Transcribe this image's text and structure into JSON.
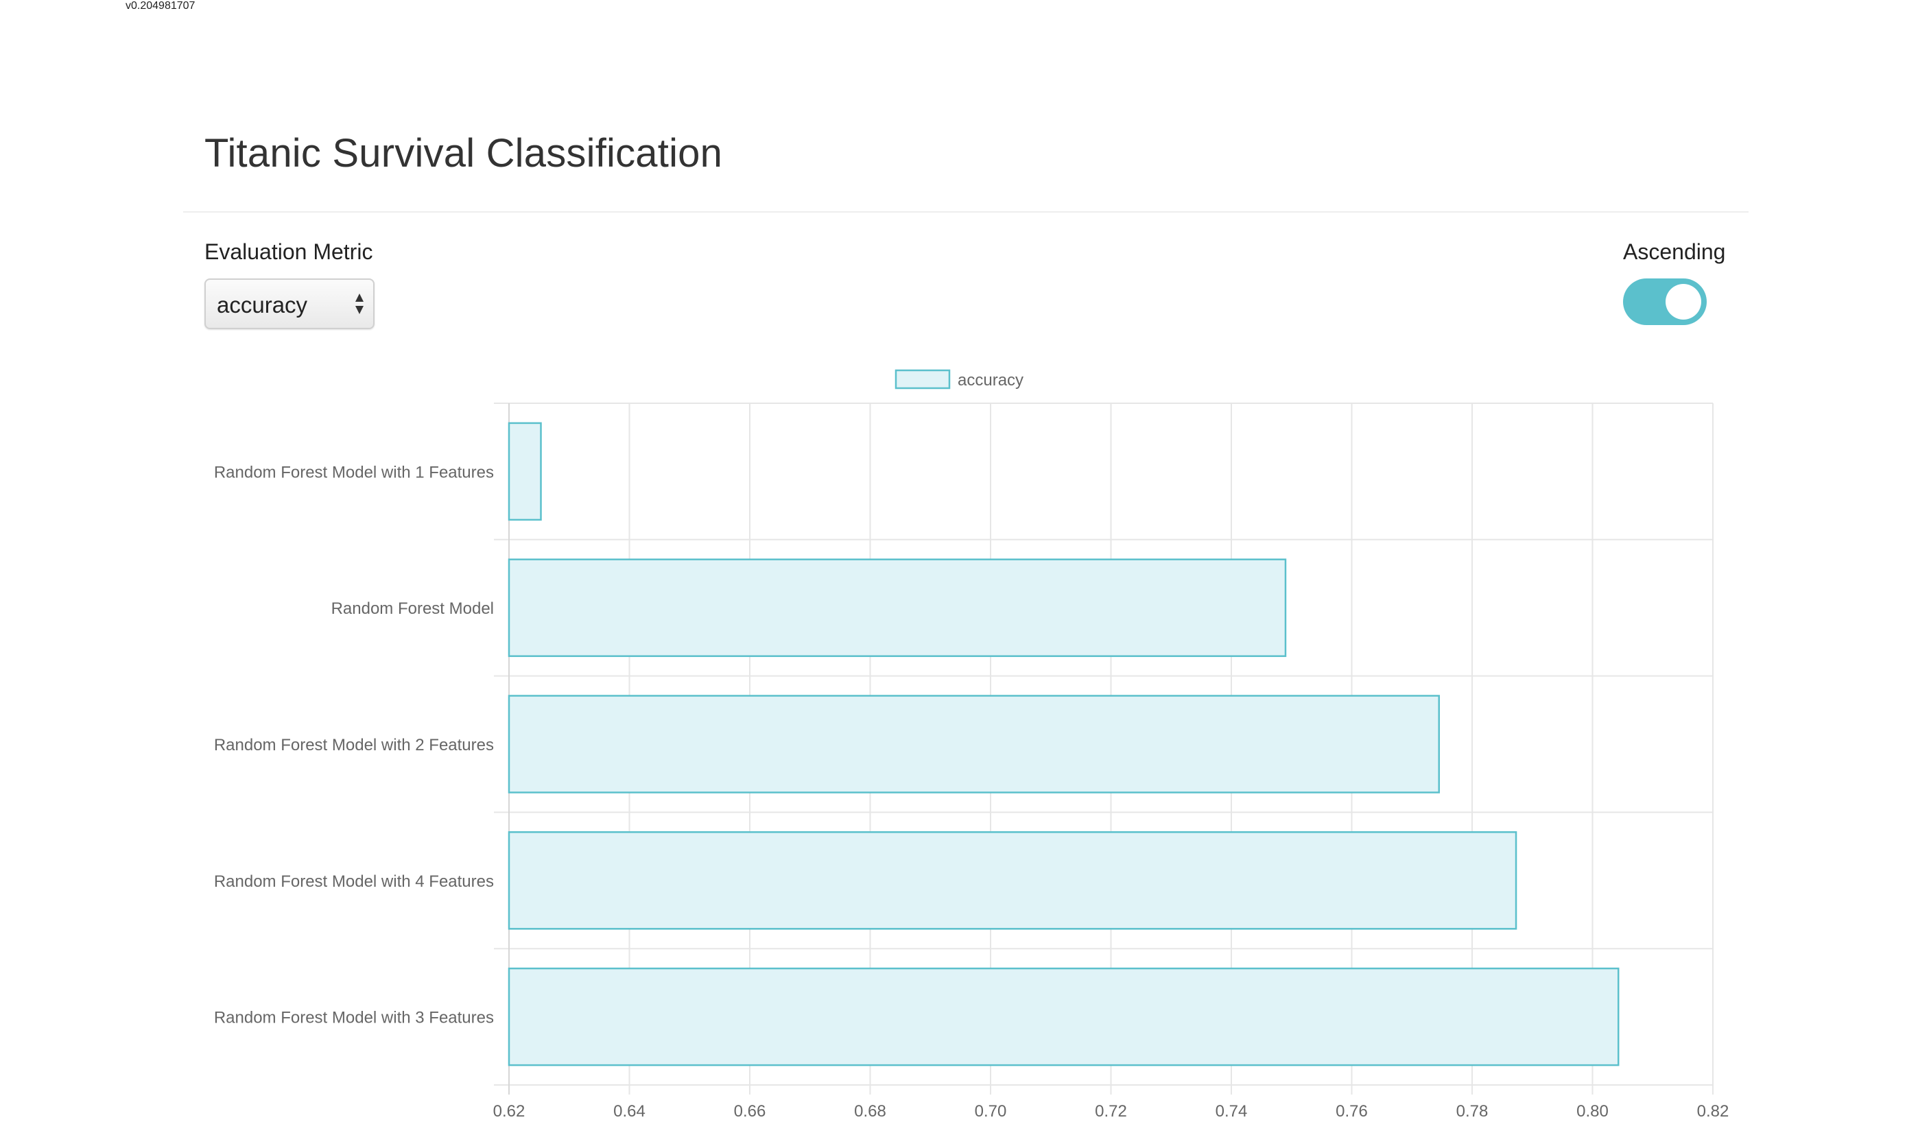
{
  "version": "v0.204981707",
  "title": "Titanic Survival Classification",
  "controls": {
    "metric_label": "Evaluation Metric",
    "metric_value": "accuracy",
    "ascending_label": "Ascending",
    "ascending_on": true
  },
  "colors": {
    "bar_fill": "#e0f3f7",
    "bar_stroke": "#5bc0cc",
    "toggle_on": "#5bc0cc",
    "grid": "#e6e6e6"
  },
  "chart_data": {
    "type": "bar",
    "orientation": "horizontal",
    "title": "",
    "xlabel": "",
    "ylabel": "",
    "legend_position": "top-center",
    "grid": true,
    "categories": [
      "Random Forest Model with 1 Features",
      "Random Forest Model",
      "Random Forest Model with 2 Features",
      "Random Forest Model with 4 Features",
      "Random Forest Model with 3 Features"
    ],
    "series": [
      {
        "name": "accuracy",
        "values": [
          0.6253,
          0.749,
          0.7745,
          0.7873,
          0.8043
        ]
      }
    ],
    "xlim": [
      0.62,
      0.82
    ],
    "xticks": [
      "0.62",
      "0.64",
      "0.66",
      "0.68",
      "0.70",
      "0.72",
      "0.74",
      "0.76",
      "0.78",
      "0.80",
      "0.82"
    ]
  }
}
